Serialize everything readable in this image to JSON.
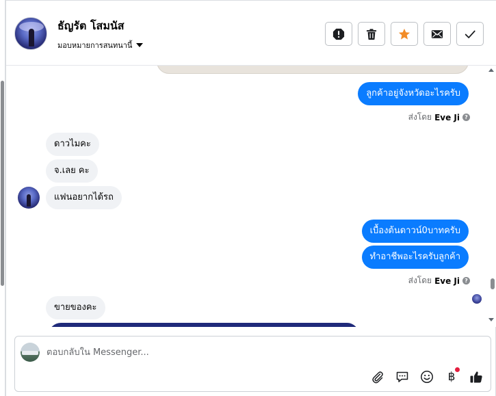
{
  "colors": {
    "outgoing_bubble": "#0a7cff",
    "incoming_bubble": "#f0f2f5",
    "star_active": "#f28c28",
    "notification_dot": "#e41e3f"
  },
  "header": {
    "contact_name": "ธัญรัต โสมนัส",
    "assign_label": "มอบหมายการสนทนานี้",
    "actions": [
      {
        "name": "report-spam-button",
        "icon": "exclamation-octagon-icon"
      },
      {
        "name": "delete-button",
        "icon": "trash-icon"
      },
      {
        "name": "star-button",
        "icon": "star-icon",
        "active": true
      },
      {
        "name": "mark-unread-button",
        "icon": "envelope-icon"
      },
      {
        "name": "mark-done-button",
        "icon": "checkmark-icon"
      }
    ]
  },
  "messages": {
    "m1": {
      "text": "ลูกค้าอยู่จังหวัดอะไรครับ",
      "direction": "outgoing"
    },
    "sent1": {
      "prefix": "ส่งโดย",
      "name": "Eve Ji"
    },
    "m2": {
      "text": "ดาวไมคะ",
      "direction": "incoming"
    },
    "m3": {
      "text": "จ.เลย คะ",
      "direction": "incoming"
    },
    "m4": {
      "text": "แฟนอยากได้รถ",
      "direction": "incoming"
    },
    "m5": {
      "text": "เบื้องต้นดาวน์0บาทครับ",
      "direction": "outgoing"
    },
    "m6": {
      "text": "ทำอาชีพอะไรครับลูกค้า",
      "direction": "outgoing"
    },
    "sent2": {
      "prefix": "ส่งโดย",
      "name": "Eve Ji"
    },
    "m7": {
      "text": "ขายของคะ",
      "direction": "incoming"
    }
  },
  "composer": {
    "placeholder": "ตอบกลับใน Messenger...",
    "value": "",
    "tools": [
      "paperclip-icon",
      "saved-reply-icon",
      "emoji-icon",
      "payment-icon",
      "thumbs-up-icon"
    ],
    "payment_symbol": "฿"
  }
}
